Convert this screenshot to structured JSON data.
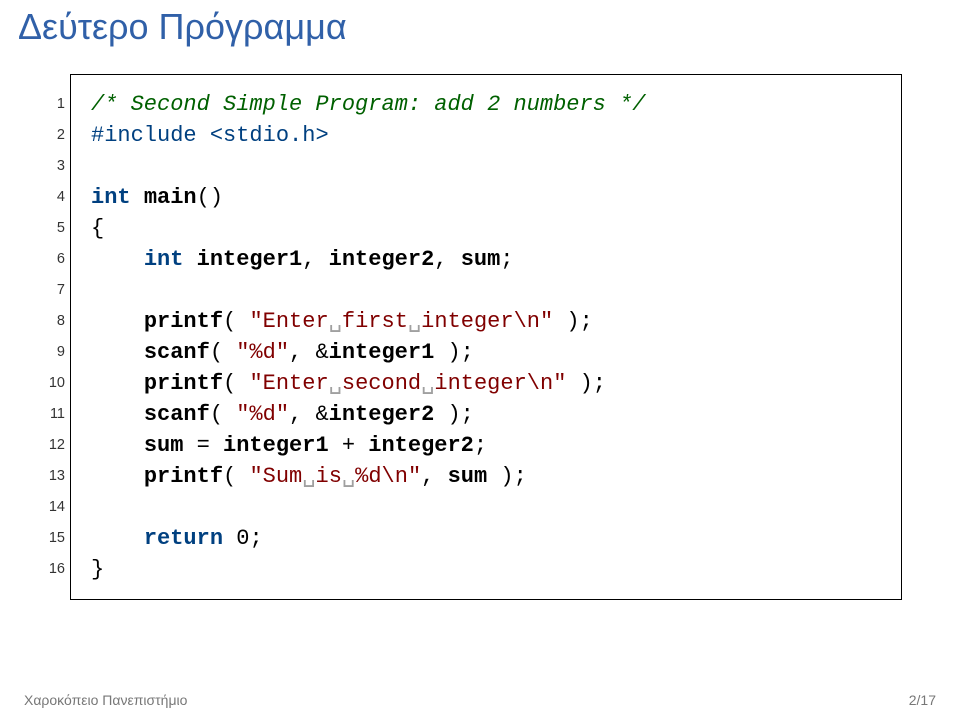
{
  "slide": {
    "title": "Δεύτερο Πρόγραμμα"
  },
  "code": {
    "lines": [
      1,
      2,
      3,
      4,
      5,
      6,
      7,
      8,
      9,
      10,
      11,
      12,
      13,
      14,
      15,
      16
    ],
    "l1": {
      "cmt": "/* Second Simple Program: add 2 numbers */"
    },
    "l2": {
      "inc1": "#include",
      "inc2": " <stdio.h>"
    },
    "l3": {
      "blank": ""
    },
    "l4": {
      "ty": "int",
      "sp": " ",
      "id": "main",
      "par": "()"
    },
    "l5": {
      "br": "{"
    },
    "l6": {
      "ind": "    ",
      "ty": "int",
      "sp": " ",
      "v1": "integer1",
      "c1": ", ",
      "v2": "integer2",
      "c2": ", ",
      "v3": "sum",
      "semi": ";"
    },
    "l7": {
      "blank": ""
    },
    "l8": {
      "ind": "    ",
      "fn": "printf",
      "op": "( ",
      "s1": "\"Enter",
      "vs1": "␣",
      "s2": "first",
      "vs2": "␣",
      "s3": "integer\\n\"",
      "cl": " );"
    },
    "l9": {
      "ind": "    ",
      "fn": "scanf",
      "op": "( ",
      "s": "\"%d\"",
      "c": ", &",
      "v": "integer1",
      "cl": " );"
    },
    "l10": {
      "ind": "    ",
      "fn": "printf",
      "op": "( ",
      "s1": "\"Enter",
      "vs1": "␣",
      "s2": "second",
      "vs2": "␣",
      "s3": "integer\\n\"",
      "cl": " );"
    },
    "l11": {
      "ind": "    ",
      "fn": "scanf",
      "op": "( ",
      "s": "\"%d\"",
      "c": ", &",
      "v": "integer2",
      "cl": " );"
    },
    "l12": {
      "ind": "    ",
      "v1": "sum",
      "eq": " = ",
      "v2": "integer1",
      "pl": " + ",
      "v3": "integer2",
      "semi": ";"
    },
    "l13": {
      "ind": "    ",
      "fn": "printf",
      "op": "( ",
      "s1": "\"Sum",
      "vs1": "␣",
      "s2": "is",
      "vs2": "␣",
      "s3": "%d\\n\"",
      "c": ", ",
      "v": "sum",
      "cl": " );"
    },
    "l14": {
      "blank": ""
    },
    "l15": {
      "ind": "    ",
      "kw": "return",
      "sp": " ",
      "num": "0",
      "semi": ";"
    },
    "l16": {
      "br": "}"
    }
  },
  "footer": {
    "university": "Χαροκόπειο Πανεπιστήμιο",
    "page": "2/17"
  }
}
